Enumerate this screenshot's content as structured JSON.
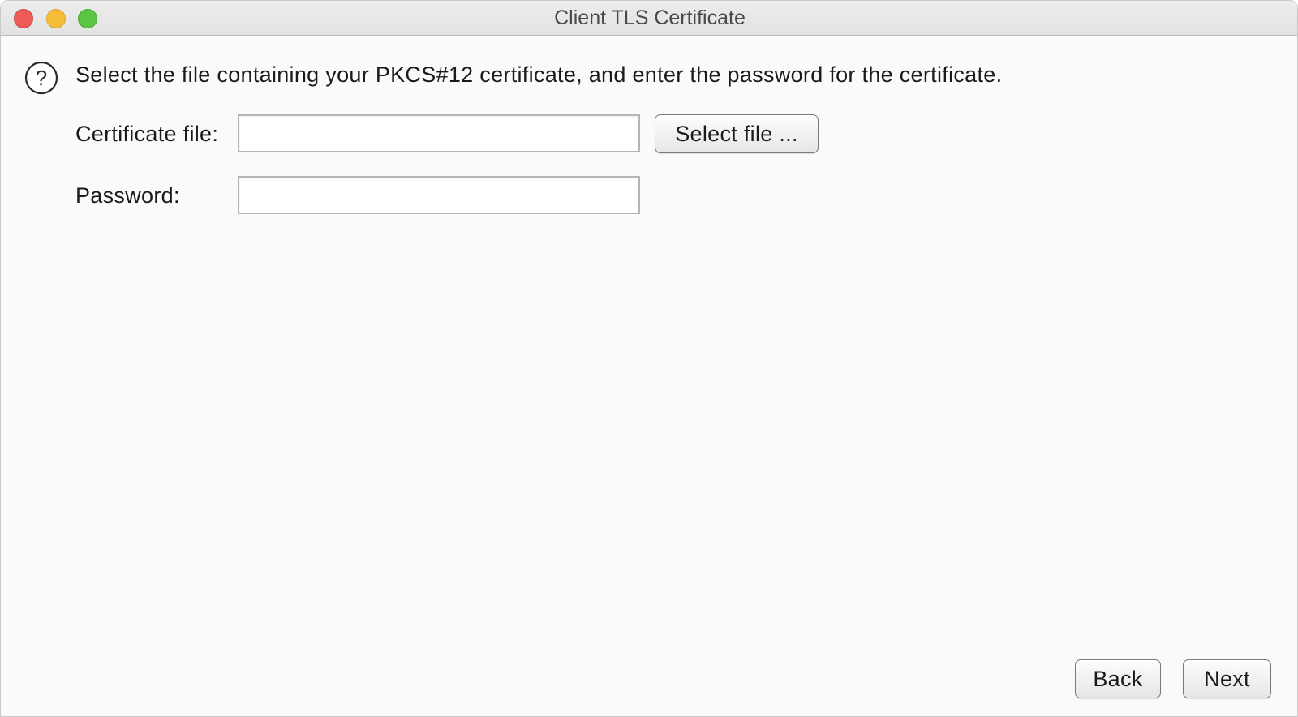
{
  "window": {
    "title": "Client TLS Certificate"
  },
  "dialog": {
    "icon": "help-icon",
    "instruction": "Select the file containing your PKCS#12 certificate, and enter the password for the certificate."
  },
  "form": {
    "certificate_label": "Certificate file:",
    "certificate_value": "",
    "select_file_label": "Select file ...",
    "password_label": "Password:",
    "password_value": ""
  },
  "footer": {
    "back_label": "Back",
    "next_label": "Next"
  },
  "colors": {
    "close": "#ee5b56",
    "minimize": "#f6bd3a",
    "zoom": "#5cc443",
    "background": "#f9fafc"
  }
}
